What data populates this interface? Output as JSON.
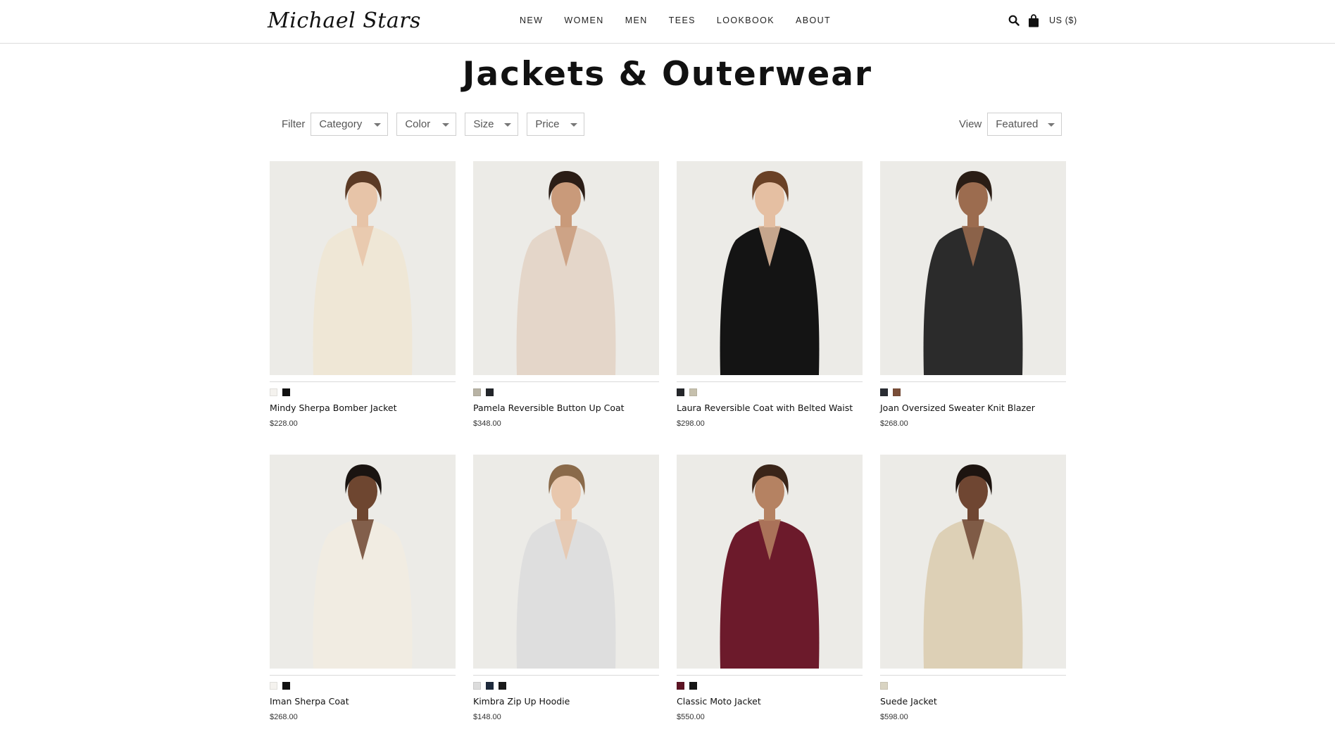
{
  "header": {
    "logo": "Michael Stars",
    "nav": [
      "NEW",
      "WOMEN",
      "MEN",
      "TEES",
      "LOOKBOOK",
      "ABOUT"
    ],
    "search_icon": "search-icon",
    "cart_icon": "shopping-bag-icon",
    "currency": "US ($)"
  },
  "page": {
    "title": "Jackets & Outerwear"
  },
  "filters": {
    "label": "Filter",
    "options": [
      "Category",
      "Color",
      "Size",
      "Price"
    ]
  },
  "view": {
    "label": "View",
    "selected": "Featured"
  },
  "products": [
    {
      "name": "Mindy Sherpa Bomber Jacket",
      "price": "$228.00",
      "swatches": [
        "#f4f2ee",
        "#111111"
      ],
      "garment": "#efe7d6",
      "bottom": "#5d7896",
      "hair": "#5b3a25",
      "skin": "#e7c4a8"
    },
    {
      "name": "Pamela Reversible Button Up Coat",
      "price": "$348.00",
      "swatches": [
        "#b8b3a4",
        "#23262b"
      ],
      "garment": "#e4d6c9",
      "bottom": "#efeadf",
      "hair": "#2b1d16",
      "skin": "#c99a7a"
    },
    {
      "name": "Laura Reversible Coat with Belted Waist",
      "price": "$298.00",
      "swatches": [
        "#25272b",
        "#c6c0ad"
      ],
      "garment": "#141414",
      "bottom": "#141414",
      "hair": "#6a4126",
      "skin": "#e5bfa2"
    },
    {
      "name": "Joan Oversized Sweater Knit Blazer",
      "price": "$268.00",
      "swatches": [
        "#2a2d33",
        "#7a4e38"
      ],
      "garment": "#2b2b2b",
      "bottom": "#1a1a1a",
      "hair": "#2a1d15",
      "skin": "#9c6c4f"
    },
    {
      "name": "Iman Sherpa Coat",
      "price": "$268.00",
      "swatches": [
        "#f4f2ee",
        "#111111"
      ],
      "garment": "#f1ece2",
      "bottom": "#f1ece2",
      "hair": "#1a1411",
      "skin": "#6e4630"
    },
    {
      "name": "Kimbra Zip Up Hoodie",
      "price": "$148.00",
      "swatches": [
        "#dcdcdc",
        "#1e2b3d",
        "#1a1a1a"
      ],
      "garment": "#dedede",
      "bottom": "#dcdcdc",
      "hair": "#8a6a4a",
      "skin": "#e8c7ad"
    },
    {
      "name": "Classic Moto Jacket",
      "price": "$550.00",
      "swatches": [
        "#5e1424",
        "#151515"
      ],
      "garment": "#6c1a2b",
      "bottom": "#111111",
      "hair": "#3a2519",
      "skin": "#b58262"
    },
    {
      "name": "Suede Jacket",
      "price": "$598.00",
      "swatches": [
        "#d9d4c2"
      ],
      "garment": "#ddd0b6",
      "bottom": "#253957",
      "hair": "#1d1410",
      "skin": "#6f4632"
    }
  ]
}
